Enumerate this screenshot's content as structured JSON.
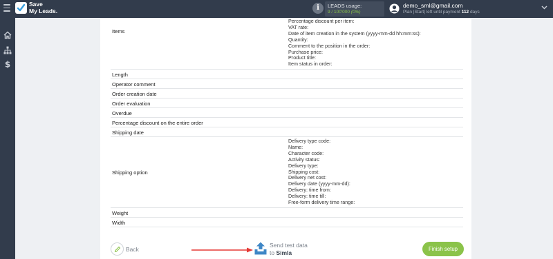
{
  "header": {
    "brand_line1": "Save",
    "brand_line2": "My Leads.",
    "usage_label": "LEADS usage:",
    "usage_count": "9 / 100'000",
    "usage_percent": "(0%)",
    "user_email": "demo_sml@gmail.com",
    "plan_prefix": "Plan |Start| left until payment",
    "plan_days": "112",
    "plan_suffix": "days",
    "icons": [
      "menu-icon",
      "logo-check-icon",
      "info-icon",
      "user-icon",
      "chevron-down-icon"
    ]
  },
  "sidebar": {
    "icons": [
      "home-icon",
      "sitemap-icon",
      "dollar-icon"
    ]
  },
  "fields": [
    {
      "name": "Items",
      "values": [
        "Percentage discount per item:",
        "VAT rate:",
        "Date of item creation in the system (yyyy-mm-dd hh:mm:ss):",
        "Quantity:",
        "Comment to the position in the order:",
        "Purchase price:",
        "Product title:",
        "Item status in order:"
      ]
    },
    {
      "name": "Length",
      "values": []
    },
    {
      "name": "Operator comment",
      "values": []
    },
    {
      "name": "Order creation date",
      "values": []
    },
    {
      "name": "Order evaluation",
      "values": []
    },
    {
      "name": "Overdue",
      "values": []
    },
    {
      "name": "Percentage discount on the entire order",
      "values": []
    },
    {
      "name": "Shipping date",
      "values": []
    },
    {
      "name": "Shipping option",
      "values": [
        "Delivery type code:",
        "Name:",
        "Character code:",
        "Activity status:",
        "Delivery type:",
        "Shipping cost:",
        "Delivery net cost:",
        "Delivery date (yyyy-mm-dd):",
        "Delivery: time from:",
        "Delivery: time till:",
        "Free-form delivery time range:"
      ]
    },
    {
      "name": "Weight",
      "values": []
    },
    {
      "name": "Width",
      "values": []
    }
  ],
  "footer": {
    "back_label": "Back",
    "send_line1": "Send test data",
    "send_line2_prefix": "to",
    "send_target": "Simla",
    "finish_label": "Finish setup",
    "accent_color": "#8bc34a",
    "arrow_color": "#e53935"
  }
}
